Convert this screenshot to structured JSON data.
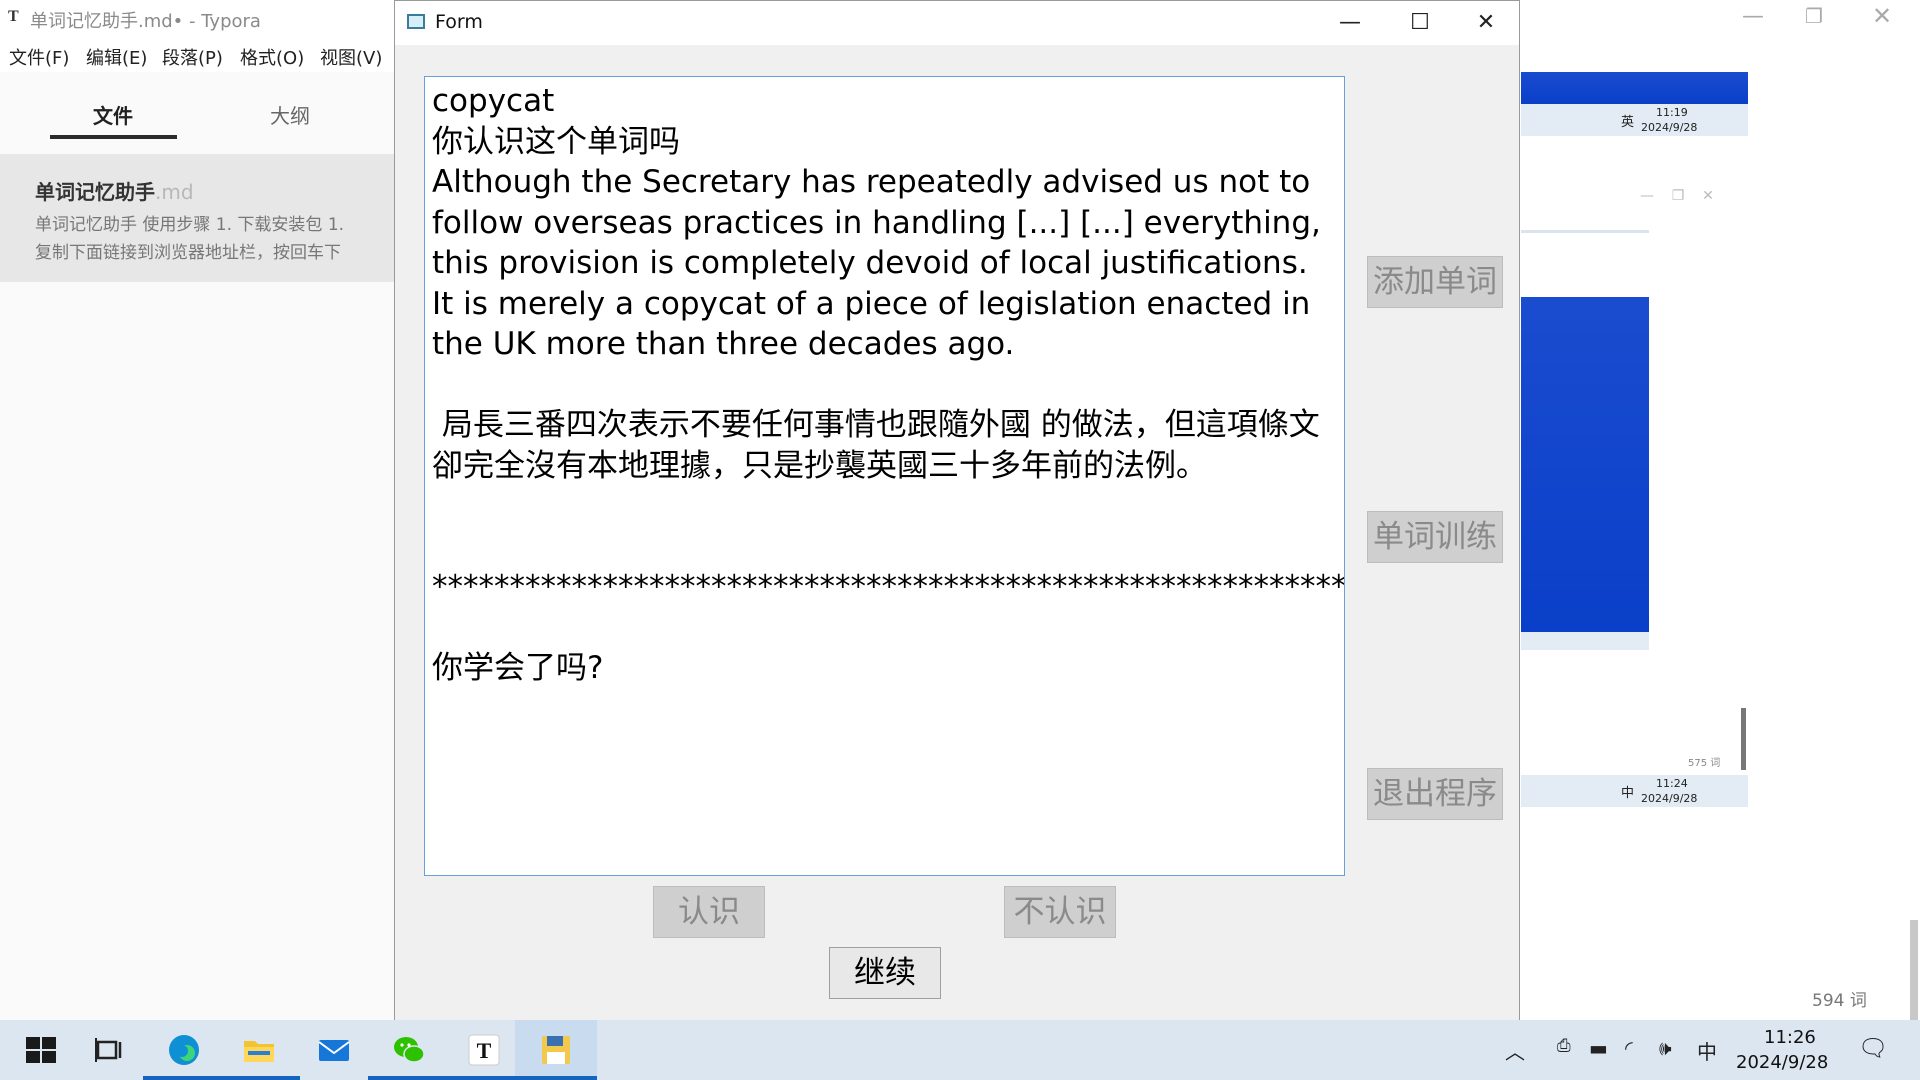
{
  "typora": {
    "app_icon": "T",
    "title": "单词记忆助手.md• - Typora",
    "menu": [
      "文件(F)",
      "编辑(E)",
      "段落(P)",
      "格式(O)",
      "视图(V)"
    ],
    "tabs": {
      "files": "文件",
      "outline": "大纲"
    },
    "file": {
      "name": "单词记忆助手",
      "ext": ".md",
      "preview_line1": "单词记忆助手 使用步骤 1. 下载安装包 1.",
      "preview_line2": "复制下面链接到浏览器地址栏，按回车下"
    },
    "word_count": "594 词"
  },
  "background_window": {
    "mini_time_1": "11:19",
    "mini_date_1": "2024/9/28",
    "mini_time_2": "11:24",
    "mini_date_2": "2024/9/28",
    "mini_ime_1": "英",
    "mini_ime_2": "中",
    "small_word_count": "575 词"
  },
  "form": {
    "title": "Form",
    "controls": {
      "minimize": "—",
      "maximize": "☐",
      "close": "✕"
    },
    "text_content": "copycat\n你认识这个单词吗\nAlthough the Secretary has repeatedly advised us not to follow overseas practices in handling [...] [...] everything, this provision is completely devoid of local justifications. It is merely a copycat of a piece of legislation enacted in the UK more than three decades ago.\n\n 局長三番四次表示不要任何事情也跟隨外國 的做法，但這項條文卻完全沒有本地理據，只是抄襲英國三十多年前的法例。\n\n ************************************************************\n\n你学会了吗?",
    "buttons": {
      "add_word": "添加单词",
      "train": "单词训练",
      "exit": "退出程序",
      "know": "认识",
      "dont_know": "不认识",
      "continue": "继续"
    }
  },
  "taskbar": {
    "tray": {
      "ime": "中"
    },
    "clock": {
      "time": "11:26",
      "date": "2024/9/28"
    }
  }
}
